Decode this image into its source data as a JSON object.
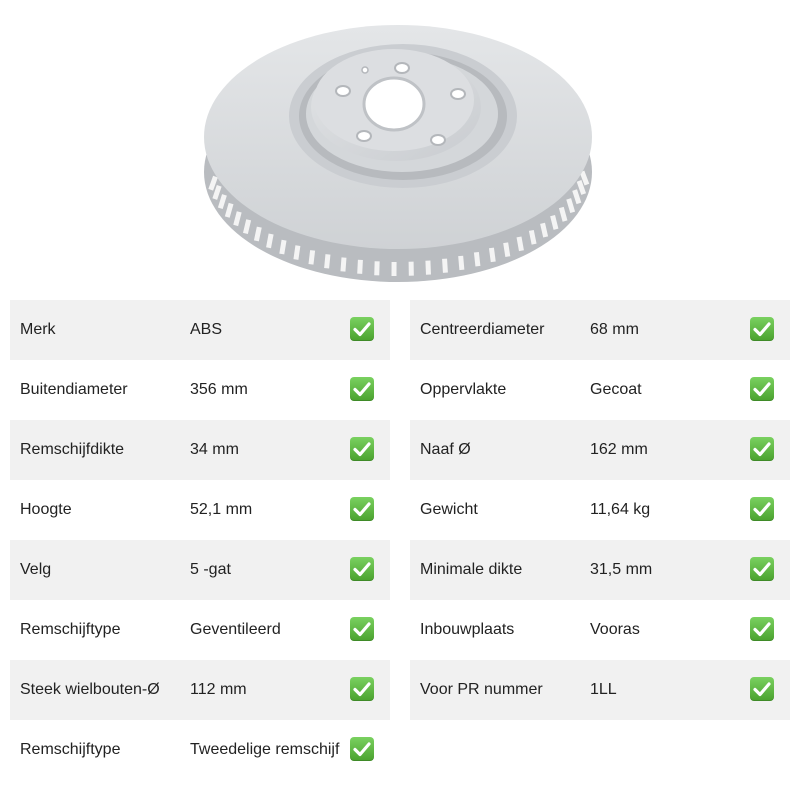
{
  "product": {
    "image_icon": "brake-disc-image"
  },
  "colors": {
    "row_shade": "#f1f1f1",
    "check_green": "#5bb53c",
    "disc_gray": "#dadcde"
  },
  "specs_left": [
    {
      "label": "Merk",
      "value": "ABS",
      "icon": "check-icon"
    },
    {
      "label": "Buitendiameter",
      "value": "356 mm",
      "icon": "check-icon"
    },
    {
      "label": "Remschijfdikte",
      "value": "34 mm",
      "icon": "check-icon"
    },
    {
      "label": "Hoogte",
      "value": "52,1 mm",
      "icon": "check-icon"
    },
    {
      "label": "Velg",
      "value": "5 -gat",
      "icon": "check-icon"
    },
    {
      "label": "Remschijftype",
      "value": "Geventileerd",
      "icon": "check-icon"
    },
    {
      "label": "Steek wielbouten-Ø",
      "value": "112 mm",
      "icon": "check-icon"
    },
    {
      "label": "Remschijftype",
      "value": "Tweedelige remschijf",
      "icon": "check-icon"
    }
  ],
  "specs_right": [
    {
      "label": "Centreerdiameter",
      "value": "68 mm",
      "icon": "check-icon"
    },
    {
      "label": "Oppervlakte",
      "value": "Gecoat",
      "icon": "check-icon"
    },
    {
      "label": "Naaf Ø",
      "value": "162 mm",
      "icon": "check-icon"
    },
    {
      "label": "Gewicht",
      "value": "11,64 kg",
      "icon": "check-icon"
    },
    {
      "label": "Minimale dikte",
      "value": "31,5 mm",
      "icon": "check-icon"
    },
    {
      "label": "Inbouwplaats",
      "value": "Vooras",
      "icon": "check-icon"
    },
    {
      "label": "Voor PR nummer",
      "value": "1LL",
      "icon": "check-icon"
    }
  ]
}
